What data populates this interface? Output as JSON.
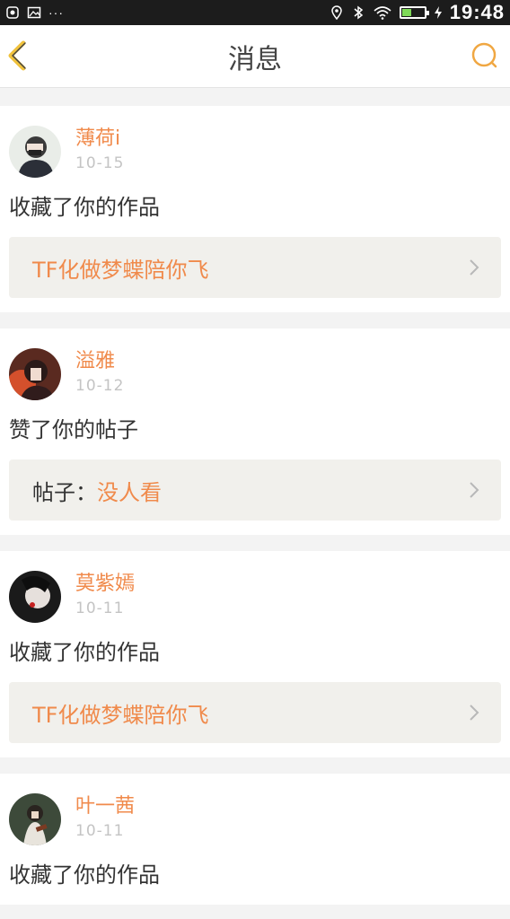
{
  "status_bar": {
    "time": "19:48",
    "dots": "···"
  },
  "header": {
    "title": "消息",
    "back_icon": "chevron-left-icon",
    "search_icon": "search-icon",
    "accent": "#f0a742"
  },
  "messages": [
    {
      "username": "薄荷i",
      "date": "10-15",
      "action": "收藏了你的作品",
      "ref_label": "",
      "ref_title": "TF化做梦蝶陪你飞"
    },
    {
      "username": "溢雅",
      "date": "10-12",
      "action": "赞了你的帖子",
      "ref_label": "帖子：",
      "ref_title": "没人看"
    },
    {
      "username": "莫紫嫣",
      "date": "10-11",
      "action": "收藏了你的作品",
      "ref_label": "",
      "ref_title": "TF化做梦蝶陪你飞"
    },
    {
      "username": "叶一茜",
      "date": "10-11",
      "action": "收藏了你的作品",
      "ref_label": "",
      "ref_title": ""
    }
  ],
  "colors": {
    "username": "#f08a4b",
    "date": "#c4c4c4",
    "ref_background": "#f1f0ec",
    "status_bar": "#1c1c1c"
  }
}
